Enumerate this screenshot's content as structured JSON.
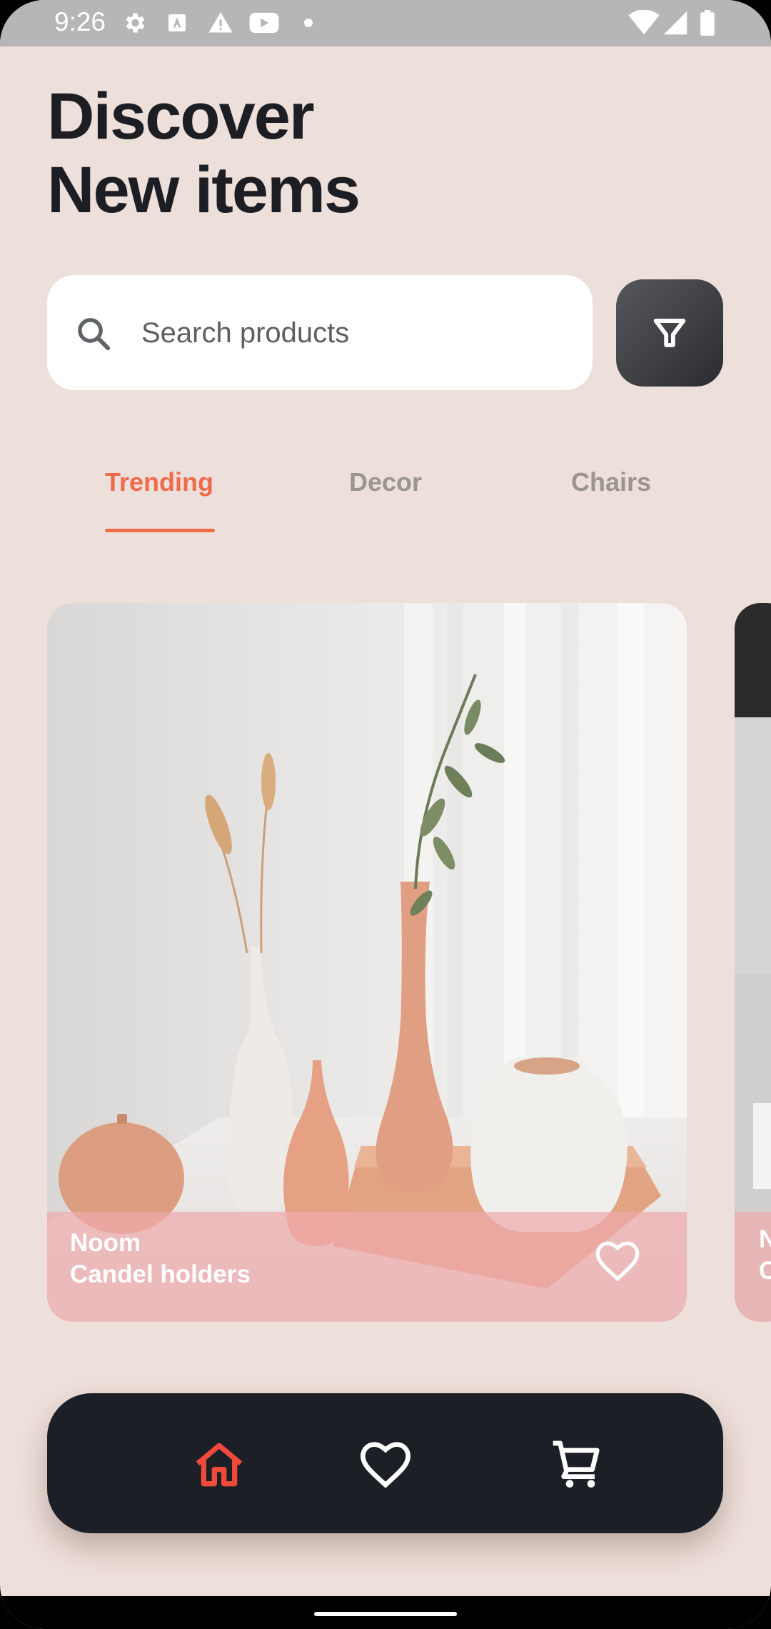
{
  "status_bar": {
    "time": "9:26",
    "left_icons": [
      "settings-icon",
      "text-icon",
      "warning-icon",
      "youtube-icon",
      "dot-icon"
    ],
    "right_icons": [
      "wifi-icon",
      "signal-icon",
      "battery-icon"
    ]
  },
  "header": {
    "line1": "Discover",
    "line2": "New items"
  },
  "search": {
    "placeholder": "Search products",
    "value": ""
  },
  "filter": {
    "icon": "filter-icon"
  },
  "tabs": [
    {
      "label": "Trending",
      "active": true
    },
    {
      "label": "Decor",
      "active": false
    },
    {
      "label": "Chairs",
      "active": false
    }
  ],
  "products": [
    {
      "brand": "Noom",
      "name": "Candel holders",
      "favorite": false
    },
    {
      "brand": "N",
      "name": "C",
      "favorite": false
    }
  ],
  "bottom_nav": [
    {
      "icon": "home-icon",
      "active": true
    },
    {
      "icon": "heart-icon",
      "active": false
    },
    {
      "icon": "cart-icon",
      "active": false
    }
  ],
  "colors": {
    "background": "#eddfd9",
    "accent": "#ef6b4c",
    "dark": "#1c1f25",
    "tab_inactive": "#9a9492"
  }
}
